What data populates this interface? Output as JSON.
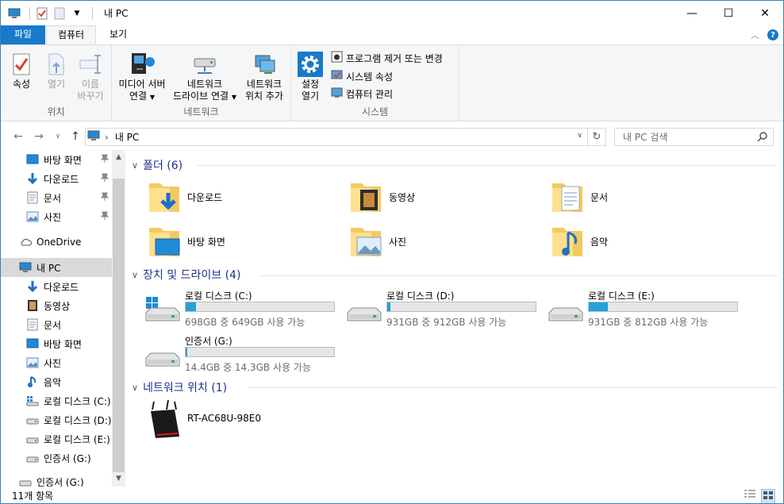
{
  "window": {
    "title": "내 PC",
    "minimize": "—",
    "maximize": "☐",
    "close": "✕"
  },
  "ribbon_tabs": {
    "file": "파일",
    "computer": "컴퓨터",
    "view": "보기"
  },
  "ribbon": {
    "location": {
      "label": "위치",
      "properties": "속성",
      "open": "열기",
      "rename_1": "이름",
      "rename_2": "바꾸기"
    },
    "network": {
      "label": "네트워크",
      "media_server_1": "미디어 서버",
      "media_server_2": "연결",
      "map_drive_1": "네트워크",
      "map_drive_2": "드라이브 연결",
      "add_location_1": "네트워크",
      "add_location_2": "위치 추가"
    },
    "system": {
      "label": "시스템",
      "open_settings_1": "설정",
      "open_settings_2": "열기",
      "uninstall": "프로그램 제거 또는 변경",
      "sys_props": "시스템 속성",
      "manage": "컴퓨터 관리"
    }
  },
  "address": {
    "path": "내 PC",
    "search_placeholder": "내 PC 검색"
  },
  "nav": {
    "quick": [
      {
        "label": "바탕 화면",
        "icon": "desktop-icon"
      },
      {
        "label": "다운로드",
        "icon": "download-icon"
      },
      {
        "label": "문서",
        "icon": "document-icon"
      },
      {
        "label": "사진",
        "icon": "picture-icon"
      }
    ],
    "onedrive": "OneDrive",
    "thispc": "내 PC",
    "pc_children": [
      {
        "label": "다운로드",
        "icon": "download-icon"
      },
      {
        "label": "동영상",
        "icon": "video-icon"
      },
      {
        "label": "문서",
        "icon": "document-icon"
      },
      {
        "label": "바탕 화면",
        "icon": "desktop-icon"
      },
      {
        "label": "사진",
        "icon": "picture-icon"
      },
      {
        "label": "음악",
        "icon": "music-icon"
      },
      {
        "label": "로컬 디스크 (C:)",
        "icon": "windows-drive-icon"
      },
      {
        "label": "로컬 디스크 (D:)",
        "icon": "drive-icon"
      },
      {
        "label": "로컬 디스크 (E:)",
        "icon": "drive-icon"
      },
      {
        "label": "인증서 (G:)",
        "icon": "drive-icon"
      }
    ],
    "extra": "인증서 (G:)"
  },
  "content": {
    "folders_header": "폴더 (6)",
    "folders": [
      {
        "label": "다운로드",
        "icon": "download-folder-icon"
      },
      {
        "label": "동영상",
        "icon": "video-folder-icon"
      },
      {
        "label": "문서",
        "icon": "document-folder-icon"
      },
      {
        "label": "바탕 화면",
        "icon": "desktop-folder-icon"
      },
      {
        "label": "사진",
        "icon": "picture-folder-icon"
      },
      {
        "label": "음악",
        "icon": "music-folder-icon"
      }
    ],
    "drives_header": "장치 및 드라이브 (4)",
    "drives": [
      {
        "name": "로컬 디스크 (C:)",
        "free": "698GB 중 649GB 사용 가능",
        "used_fraction": 0.07
      },
      {
        "name": "로컬 디스크 (D:)",
        "free": "931GB 중 912GB 사용 가능",
        "used_fraction": 0.02
      },
      {
        "name": "로컬 디스크 (E:)",
        "free": "931GB 중 812GB 사용 가능",
        "used_fraction": 0.13
      },
      {
        "name": "인증서 (G:)",
        "free": "14.4GB 중 14.3GB 사용 가능",
        "used_fraction": 0.01
      }
    ],
    "network_header": "네트워크 위치 (1)",
    "network_device": "RT-AC68U-98E0"
  },
  "status": {
    "count": "11개 항목"
  },
  "colors": {
    "accent": "#1979ca",
    "section": "#1e3287",
    "bar_fill": "#26a0da",
    "selection": "#d9d9d9"
  }
}
